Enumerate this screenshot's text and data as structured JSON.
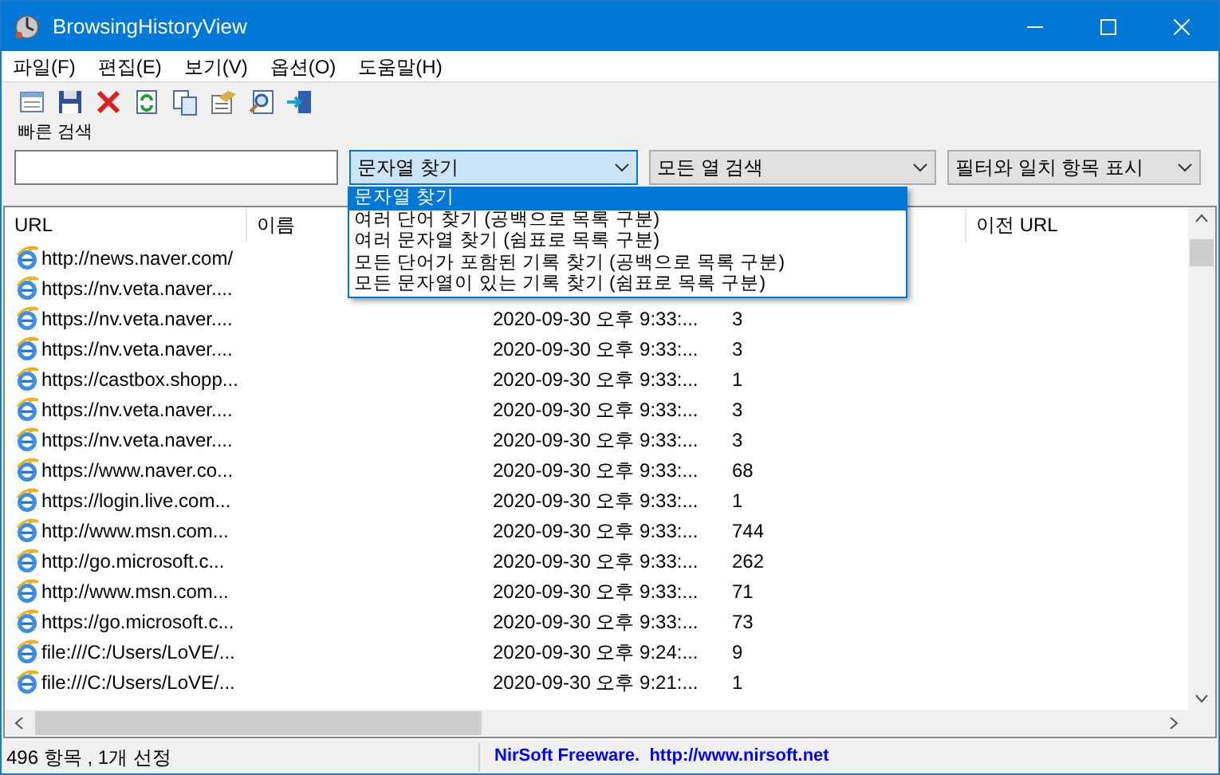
{
  "window": {
    "title": "BrowsingHistoryView"
  },
  "menu": [
    "파일(F)",
    "편집(E)",
    "보기(V)",
    "옵션(O)",
    "도움말(H)"
  ],
  "quick_search": {
    "label": "빠른 검색",
    "combos": [
      {
        "value": "문자열 찾기",
        "focused": true
      },
      {
        "value": "모든 열 검색",
        "focused": false
      },
      {
        "value": "필터와 일치 항목 표시",
        "focused": false
      }
    ],
    "dropdown": [
      {
        "label": "문자열 찾기",
        "selected": true
      },
      {
        "label": "여러 단어 찾기 (공백으로 목록 구분)",
        "selected": false
      },
      {
        "label": "여러 문자열 찾기 (쉼표로 목록 구분)",
        "selected": false
      },
      {
        "label": "모든 단어가 포함된 기록 찾기 (공백으로 목록 구분)",
        "selected": false
      },
      {
        "label": "모든 문자열이 있는 기록 찾기 (쉼표로 목록 구분)",
        "selected": false
      }
    ]
  },
  "table": {
    "columns": [
      "URL",
      "이름",
      "이전 URL"
    ],
    "rows": [
      {
        "url": "http://news.naver.com/"
      },
      {
        "url": "https://nv.veta.naver...."
      },
      {
        "url": "https://nv.veta.naver....",
        "visit_time": "2020-09-30 오후 9:33:...",
        "count": "3"
      },
      {
        "url": "https://nv.veta.naver....",
        "visit_time": "2020-09-30 오후 9:33:...",
        "count": "3"
      },
      {
        "url": "https://castbox.shopp...",
        "visit_time": "2020-09-30 오후 9:33:...",
        "count": "1"
      },
      {
        "url": "https://nv.veta.naver....",
        "visit_time": "2020-09-30 오후 9:33:...",
        "count": "3"
      },
      {
        "url": "https://nv.veta.naver....",
        "visit_time": "2020-09-30 오후 9:33:...",
        "count": "3"
      },
      {
        "url": "https://www.naver.co...",
        "visit_time": "2020-09-30 오후 9:33:...",
        "count": "68"
      },
      {
        "url": "https://login.live.com...",
        "visit_time": "2020-09-30 오후 9:33:...",
        "count": "1"
      },
      {
        "url": "http://www.msn.com...",
        "visit_time": "2020-09-30 오후 9:33:...",
        "count": "744"
      },
      {
        "url": "http://go.microsoft.c...",
        "visit_time": "2020-09-30 오후 9:33:...",
        "count": "262"
      },
      {
        "url": "http://www.msn.com...",
        "visit_time": "2020-09-30 오후 9:33:...",
        "count": "71"
      },
      {
        "url": "https://go.microsoft.c...",
        "visit_time": "2020-09-30 오후 9:33:...",
        "count": "73"
      },
      {
        "url": "file:///C:/Users/LoVE/...",
        "visit_time": "2020-09-30 오후 9:24:...",
        "count": "9"
      },
      {
        "url": "file:///C:/Users/LoVE/...",
        "visit_time": "2020-09-30 오후 9:21:...",
        "count": "1"
      }
    ]
  },
  "status_bar": {
    "count": "496 항목 , 1개 선정",
    "credit": "NirSoft Freeware.  http://www.nirsoft.net"
  }
}
